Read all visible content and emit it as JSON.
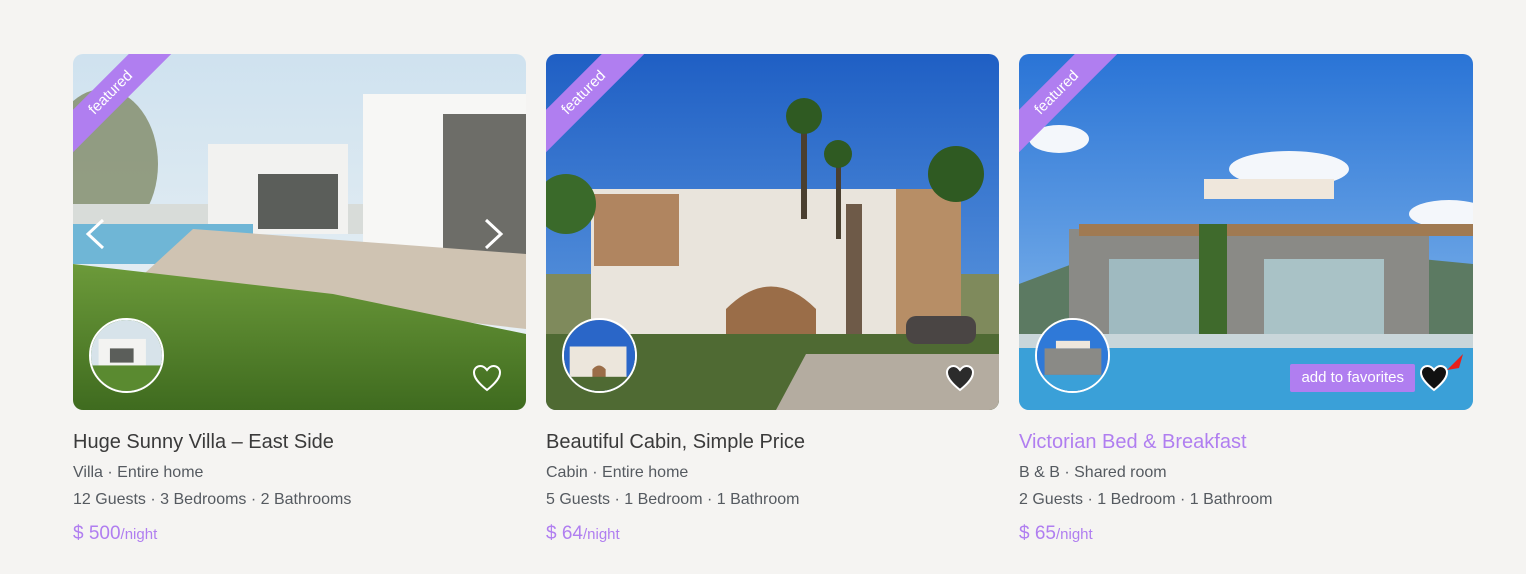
{
  "listings": [
    {
      "badge": "featured",
      "title": "Huge Sunny Villa – East Side",
      "type_line": "Villa · Entire home",
      "capacity_line": "12 Guests · 3 Bedrooms · 2 Bathrooms",
      "price": "$ 500",
      "price_unit": "/night"
    },
    {
      "badge": "featured",
      "title": "Beautiful Cabin, Simple Price",
      "type_line": "Cabin · Entire home",
      "capacity_line": "5 Guests · 1 Bedroom · 1 Bathroom",
      "price": "$ 64",
      "price_unit": "/night"
    },
    {
      "badge": "featured",
      "title": "Victorian Bed & Breakfast",
      "type_line": "B & B · Shared room",
      "capacity_line": "2 Guests · 1 Bedroom · 1 Bathroom",
      "price": "$ 65",
      "price_unit": "/night",
      "tooltip": "add to favorites"
    }
  ],
  "colors": {
    "accent": "#b07ef0",
    "background": "#f5f4f2",
    "title_text": "#3a3a3a",
    "meta_text": "#555a60"
  }
}
